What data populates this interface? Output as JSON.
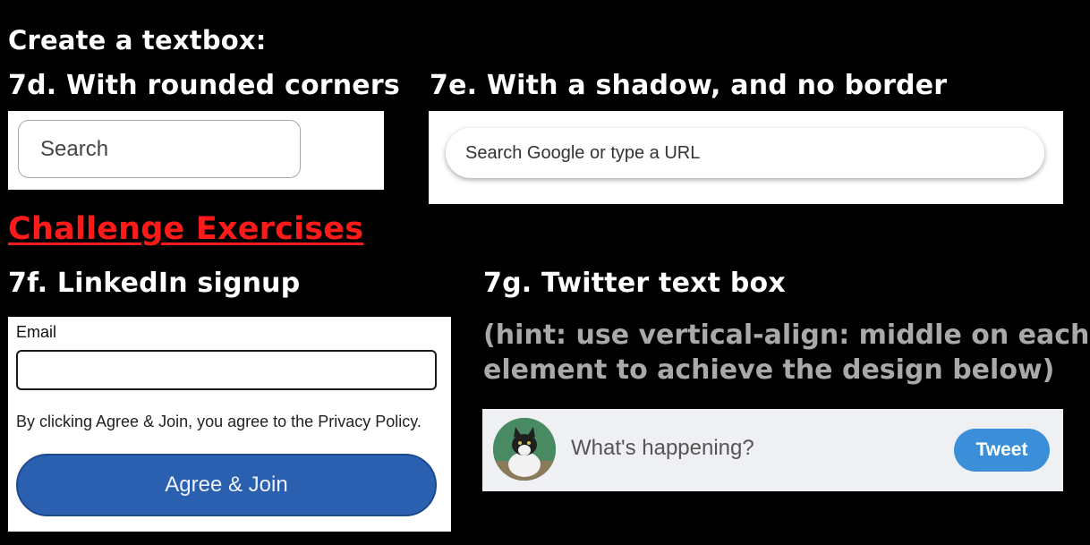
{
  "heading": "Create a textbox:",
  "ex7d": {
    "title": "7d. With rounded corners",
    "placeholder": "Search"
  },
  "ex7e": {
    "title": "7e. With a shadow, and no border",
    "placeholder": "Search Google or type a URL"
  },
  "challenge_title": "Challenge Exercises",
  "ex7f": {
    "title": "7f. LinkedIn signup",
    "email_label": "Email",
    "agree_text": "By clicking Agree & Join, you agree to the Privacy Policy.",
    "button_label": "Agree & Join"
  },
  "ex7g": {
    "title": "7g. Twitter text box",
    "hint_line1": "(hint: use vertical-align: middle on each",
    "hint_line2": "element to achieve the design below)",
    "placeholder": "What's happening?",
    "button_label": "Tweet",
    "avatar_icon": "cat-avatar-icon"
  },
  "colors": {
    "background": "#000000",
    "challenge": "#ff1a1a",
    "hint": "#a9a9a9",
    "linkedin_button": "#2b5fb0",
    "tweet_button": "#3b8fd9"
  }
}
